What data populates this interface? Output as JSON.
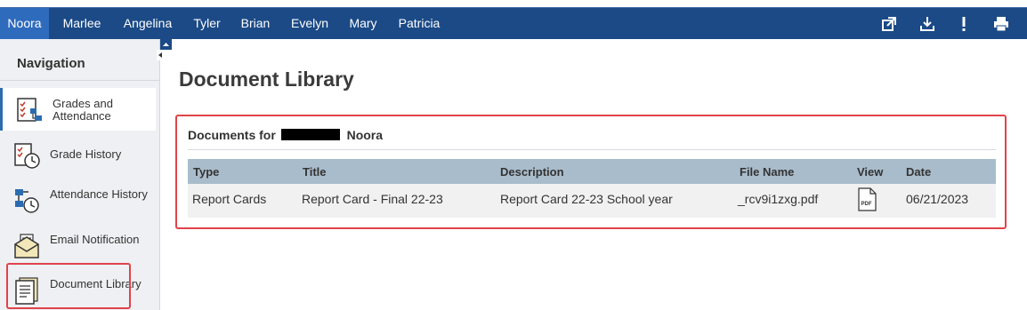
{
  "students": [
    {
      "name": "Noora",
      "active": true
    },
    {
      "name": "Marlee",
      "active": false
    },
    {
      "name": "Angelina",
      "active": false
    },
    {
      "name": "Tyler",
      "active": false
    },
    {
      "name": "Brian",
      "active": false
    },
    {
      "name": "Evelyn",
      "active": false
    },
    {
      "name": "Mary",
      "active": false
    },
    {
      "name": "Patricia",
      "active": false
    }
  ],
  "toolbar": {
    "icons": [
      "open-in-new-window-icon",
      "download-icon",
      "alert-icon",
      "printer-icon"
    ]
  },
  "nav": {
    "heading": "Navigation",
    "items": [
      {
        "label": "Grades and Attendance",
        "icon": "grades-attendance-icon",
        "selected": true
      },
      {
        "label": "Grade History",
        "icon": "grade-history-icon",
        "selected": false
      },
      {
        "label": "Attendance History",
        "icon": "attendance-history-icon",
        "selected": false
      },
      {
        "label": "Email Notification",
        "icon": "email-notification-icon",
        "selected": false
      },
      {
        "label": "Document Library",
        "icon": "document-library-icon",
        "selected": false
      }
    ]
  },
  "page": {
    "title": "Document Library"
  },
  "documents": {
    "heading_prefix": "Documents for",
    "heading_name": "Noora",
    "columns": [
      "Type",
      "Title",
      "Description",
      "File Name",
      "View",
      "Date"
    ],
    "rows": [
      {
        "type": "Report Cards",
        "title": "Report Card - Final 22-23",
        "description": "Report Card 22-23 School year",
        "file_name": "_rcv9i1zxg.pdf",
        "view_icon": "pdf-icon",
        "date": "06/21/2023"
      }
    ]
  },
  "colors": {
    "topbar": "#1b4a86",
    "active_tab": "#2f6bbd",
    "table_header": "#a9bccb",
    "highlight": "#e0434a"
  }
}
